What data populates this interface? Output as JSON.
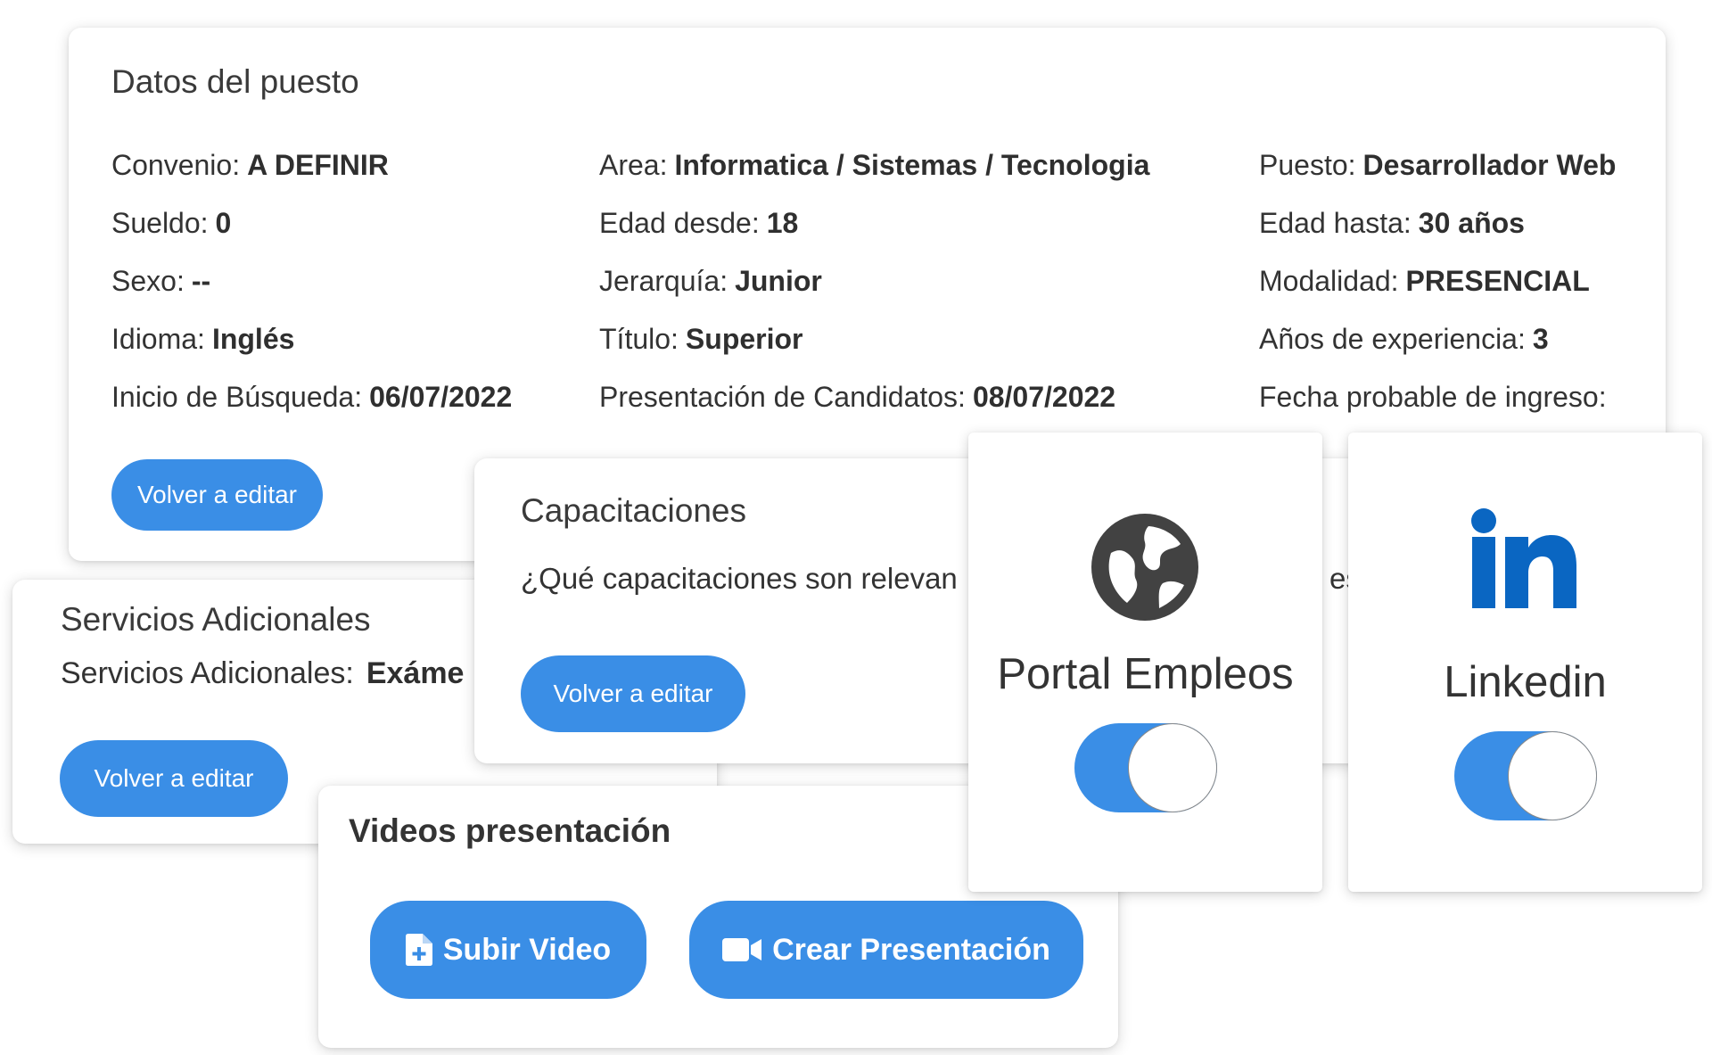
{
  "datos": {
    "title": "Datos del puesto",
    "col1": [
      {
        "label": "Convenio:",
        "value": "A DEFINIR"
      },
      {
        "label": "Sueldo:",
        "value": "0"
      },
      {
        "label": "Sexo:",
        "value": "--"
      },
      {
        "label": "Idioma:",
        "value": "Inglés"
      },
      {
        "label": "Inicio de Búsqueda:",
        "value": "06/07/2022"
      }
    ],
    "col2": [
      {
        "label": "Area:",
        "value": "Informatica / Sistemas / Tecnologia"
      },
      {
        "label": "Edad desde:",
        "value": "18"
      },
      {
        "label": "Jerarquía:",
        "value": "Junior"
      },
      {
        "label": "Título:",
        "value": "Superior"
      },
      {
        "label": "Presentación de Candidatos:",
        "value": "08/07/2022"
      }
    ],
    "col3": [
      {
        "label": "Puesto:",
        "value": "Desarrollador Web"
      },
      {
        "label": "Edad hasta:",
        "value": "30 años"
      },
      {
        "label": "Modalidad:",
        "value": "PRESENCIAL"
      },
      {
        "label": "Años de experiencia:",
        "value": "3"
      },
      {
        "label": "Fecha probable de ingreso:",
        "value": ""
      }
    ],
    "edit_label": "Volver a editar"
  },
  "servicios": {
    "title": "Servicios Adicionales",
    "line_label": "Servicios Adicionales:",
    "line_value": "Exáme",
    "edit_label": "Volver a editar"
  },
  "capacitaciones": {
    "title": "Capacitaciones",
    "question": "¿Qué capacitaciones son relevan",
    "question_tail": "es",
    "edit_label": "Volver a editar"
  },
  "videos": {
    "title": "Videos presentación",
    "upload_label": "Subir Video",
    "create_label": "Crear Presentación"
  },
  "portal": {
    "label": "Portal Empleos",
    "icon": "globe-icon",
    "enabled": true
  },
  "linkedin": {
    "label": "Linkedin",
    "icon": "linkedin-icon",
    "enabled": true
  },
  "colors": {
    "accent": "#3a8ee6",
    "linkedin": "#0a66c2",
    "globe": "#424242"
  }
}
